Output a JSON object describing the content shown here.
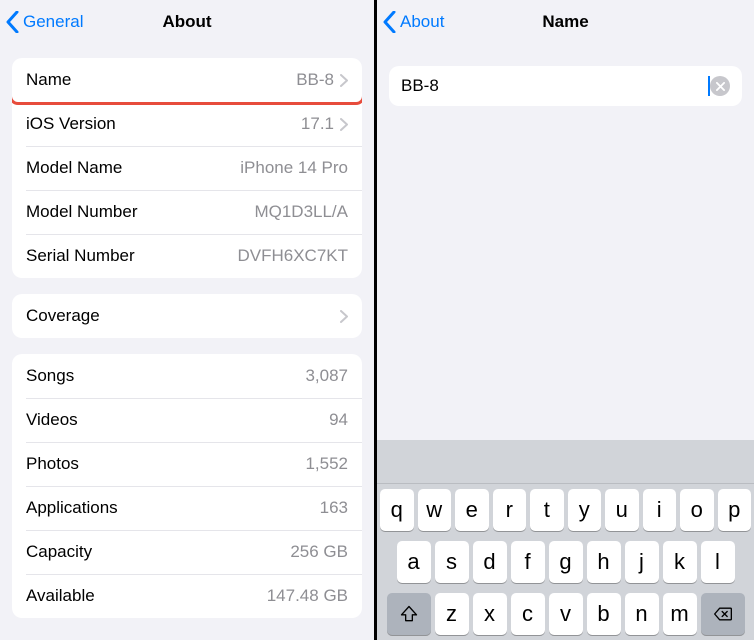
{
  "left": {
    "back_label": "General",
    "title": "About",
    "rows": {
      "name": {
        "label": "Name",
        "value": "BB-8"
      },
      "ios": {
        "label": "iOS Version",
        "value": "17.1"
      },
      "model_name": {
        "label": "Model Name",
        "value": "iPhone 14 Pro"
      },
      "model_num": {
        "label": "Model Number",
        "value": "MQ1D3LL/A"
      },
      "serial": {
        "label": "Serial Number",
        "value": "DVFH6XC7KT"
      }
    },
    "coverage_label": "Coverage",
    "stats": {
      "songs": {
        "label": "Songs",
        "value": "3,087"
      },
      "videos": {
        "label": "Videos",
        "value": "94"
      },
      "photos": {
        "label": "Photos",
        "value": "1,552"
      },
      "apps": {
        "label": "Applications",
        "value": "163"
      },
      "capacity": {
        "label": "Capacity",
        "value": "256 GB"
      },
      "avail": {
        "label": "Available",
        "value": "147.48 GB"
      }
    }
  },
  "right": {
    "back_label": "About",
    "title": "Name",
    "input_value": "BB-8"
  },
  "keyboard": {
    "row1": [
      "q",
      "w",
      "e",
      "r",
      "t",
      "y",
      "u",
      "i",
      "o",
      "p"
    ],
    "row2": [
      "a",
      "s",
      "d",
      "f",
      "g",
      "h",
      "j",
      "k",
      "l"
    ],
    "row3": [
      "z",
      "x",
      "c",
      "v",
      "b",
      "n",
      "m"
    ]
  }
}
